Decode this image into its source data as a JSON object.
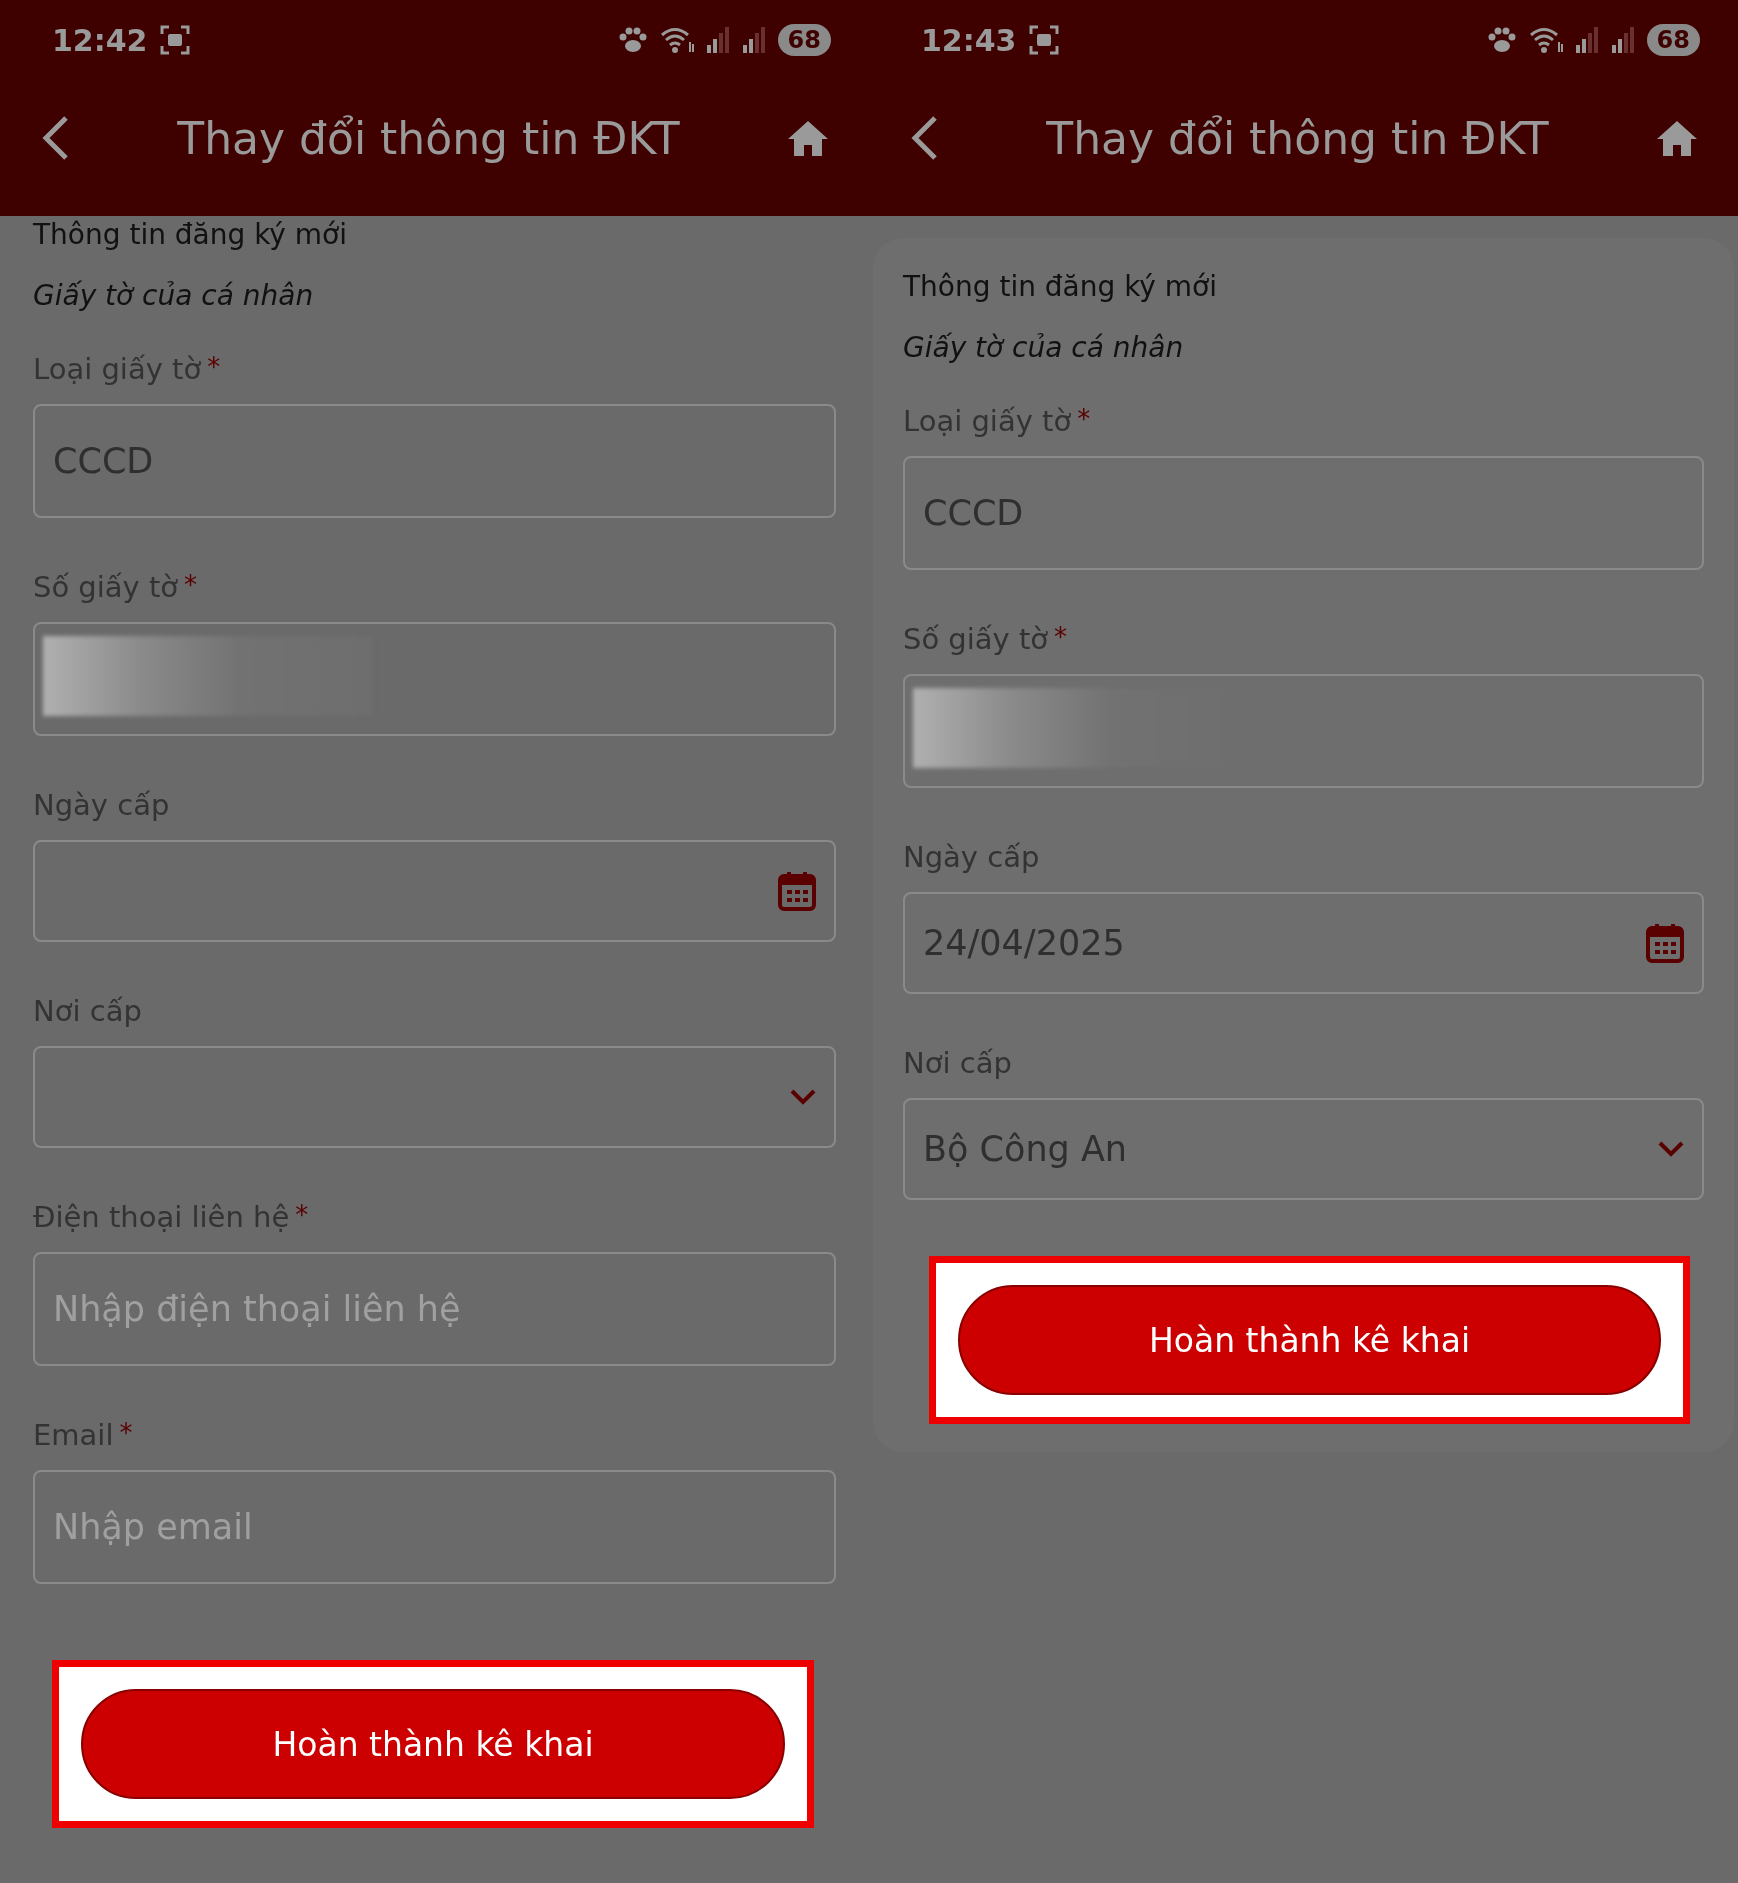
{
  "screens": [
    {
      "status_bar": {
        "time": "12:42",
        "battery": "68"
      },
      "header": {
        "title": "Thay đổi thông tin ĐKT"
      },
      "form": {
        "section_title": "Thông tin đăng ký mới",
        "subsection": "Giấy tờ của cá nhân",
        "fields": [
          {
            "kind": "text",
            "label": "Loại giấy tờ",
            "mark": "*",
            "value": "CCCD"
          },
          {
            "kind": "masked",
            "label": "Số giấy tờ",
            "mark": "*"
          },
          {
            "kind": "date",
            "label": "Ngày cấp"
          },
          {
            "kind": "select",
            "label": "Nơi cấp"
          },
          {
            "kind": "text",
            "label": "Điện thoại liên hệ",
            "mark": "*",
            "placeholder": "Nhập điện thoại liên hệ"
          },
          {
            "kind": "text",
            "label": "Email",
            "mark": "*",
            "placeholder": "Nhập email"
          }
        ],
        "submit": {
          "label": "Hoàn thành kê khai",
          "highlighted": true
        }
      }
    },
    {
      "status_bar": {
        "time": "12:43",
        "battery": "68"
      },
      "header": {
        "title": "Thay đổi thông tin ĐKT"
      },
      "card": true,
      "form": {
        "section_title": "Thông tin đăng ký mới",
        "subsection": "Giấy tờ của cá nhân",
        "fields": [
          {
            "kind": "text",
            "label": "Loại giấy tờ",
            "mark": "*",
            "value": "CCCD"
          },
          {
            "kind": "masked",
            "label": "Số giấy tờ",
            "mark": "*"
          },
          {
            "kind": "date",
            "label": "Ngày cấp",
            "value": "24/04/2025"
          },
          {
            "kind": "select",
            "label": "Nơi cấp",
            "value": "Bộ Công An"
          }
        ],
        "submit": {
          "label": "Hoàn thành kê khai",
          "highlighted": true
        }
      }
    }
  ]
}
